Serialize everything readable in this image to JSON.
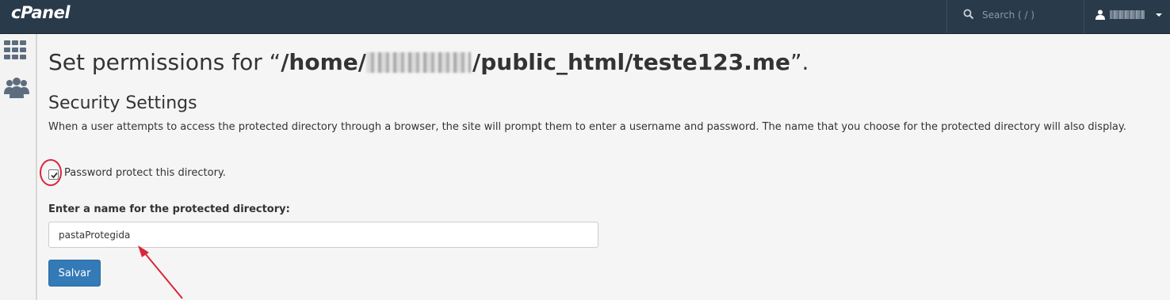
{
  "header": {
    "logo": "cPanel",
    "search_placeholder": "Search ( / )",
    "user_icon": "user-icon"
  },
  "sidebar": {
    "items": [
      {
        "icon": "grid-icon"
      },
      {
        "icon": "users-icon"
      }
    ]
  },
  "main": {
    "title_prefix": "Set permissions for “",
    "path_start": "/home/",
    "path_end": "/public_html/teste123.me",
    "title_suffix": "”.",
    "section_title": "Security Settings",
    "description": "When a user attempts to access the protected directory through a browser, the site will prompt them to enter a username and password. The name that you choose for the protected directory will also display.",
    "checkbox_label": "Password protect this directory.",
    "checkbox_checked": true,
    "field_label": "Enter a name for the protected directory:",
    "field_value": "pastaProtegida",
    "save_label": "Salvar"
  },
  "colors": {
    "topbar": "#293a4a",
    "primary": "#337ab7",
    "annotation": "#d9263a"
  }
}
